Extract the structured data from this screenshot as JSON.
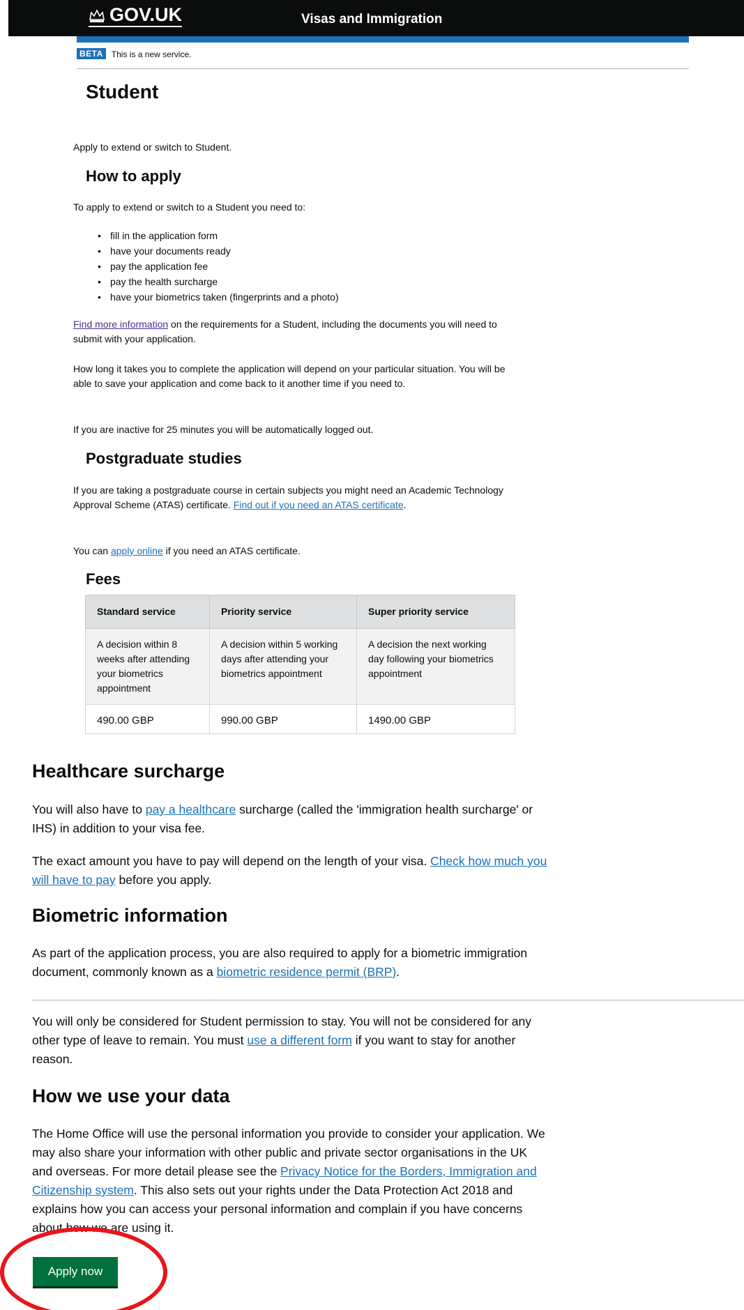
{
  "header": {
    "logo_text": "GOV.UK",
    "service_name": "Visas and Immigration",
    "accent_color": "#1d70b8"
  },
  "phase": {
    "tag": "BETA",
    "text": "This is a new service."
  },
  "page_title": "Student",
  "intro": "Apply to extend or switch to Student.",
  "how_to_apply": {
    "heading": "How to apply",
    "lead": "To apply to extend or switch to a Student you need to:",
    "steps": [
      "fill in the application form",
      "have your documents ready",
      "pay the application fee",
      "pay the health surcharge",
      "have your biometrics taken (fingerprints and a photo)"
    ],
    "more_info_link": "Find more information",
    "more_info_rest": " on the requirements for a Student, including the documents you will need to submit with your application.",
    "duration_text": "How long it takes you to complete the application will depend on your particular situation. You will be able to save your application and come back to it another time if you need to.",
    "timeout_text": "If you are inactive for 25 minutes you will be automatically logged out."
  },
  "postgraduate": {
    "heading": "Postgraduate studies",
    "text": "If you are taking a postgraduate course in certain subjects you might need an Academic Technology Approval Scheme (ATAS) certificate. ",
    "atas_link": "Find out if you need an ATAS certificate",
    "atas_end": ".",
    "apply_pre": "You can ",
    "apply_link": "apply online",
    "apply_post": " if you need an ATAS certificate."
  },
  "fees": {
    "heading": "Fees",
    "columns": [
      "Standard service",
      "Priority service",
      "Super priority service"
    ],
    "descriptions": [
      "A decision within 8 weeks after attending your biometrics appointment",
      "A decision within 5 working days after attending your biometrics appointment",
      "A decision the next working day following your biometrics appointment"
    ],
    "prices": [
      "490.00 GBP",
      "990.00 GBP",
      "1490.00 GBP"
    ]
  },
  "healthcare": {
    "heading": "Healthcare surcharge",
    "p1_pre": "You will also have to ",
    "p1_link": "pay a healthcare",
    "p1_post": " surcharge (called the 'immigration health surcharge' or IHS) in addition to your visa fee.",
    "p2_pre": "The exact amount you have to pay will depend on the length of your visa. ",
    "p2_link": "Check how much you will have to pay",
    "p2_post": " before you apply."
  },
  "biometric": {
    "heading": "Biometric information",
    "p_pre": "As part of the application process, you are also required to apply for a biometric immigration document, commonly known as a ",
    "p_link": "biometric residence permit (BRP)",
    "p_post": "."
  },
  "permission": {
    "p_pre": "You will only be considered for Student permission to stay. You will not be considered for any other type of leave to remain. You must ",
    "p_link": "use a different form",
    "p_post": " if you want to stay for another reason."
  },
  "data_use": {
    "heading": "How we use your data",
    "p_pre": "The Home Office will use the personal information you provide to consider your application. We may also share your information with other public and private sector organisations in the UK and overseas. For more detail please see the ",
    "p_link": "Privacy Notice for the Borders, Immigration and Citizenship system",
    "p_post": ". This also sets out your rights under the Data Protection Act 2018 and explains how you can access your personal information and complain if you have concerns about how we are using it."
  },
  "apply_button": {
    "label": "Apply now",
    "color": "#00703c"
  },
  "highlight_color": "#e8151b"
}
